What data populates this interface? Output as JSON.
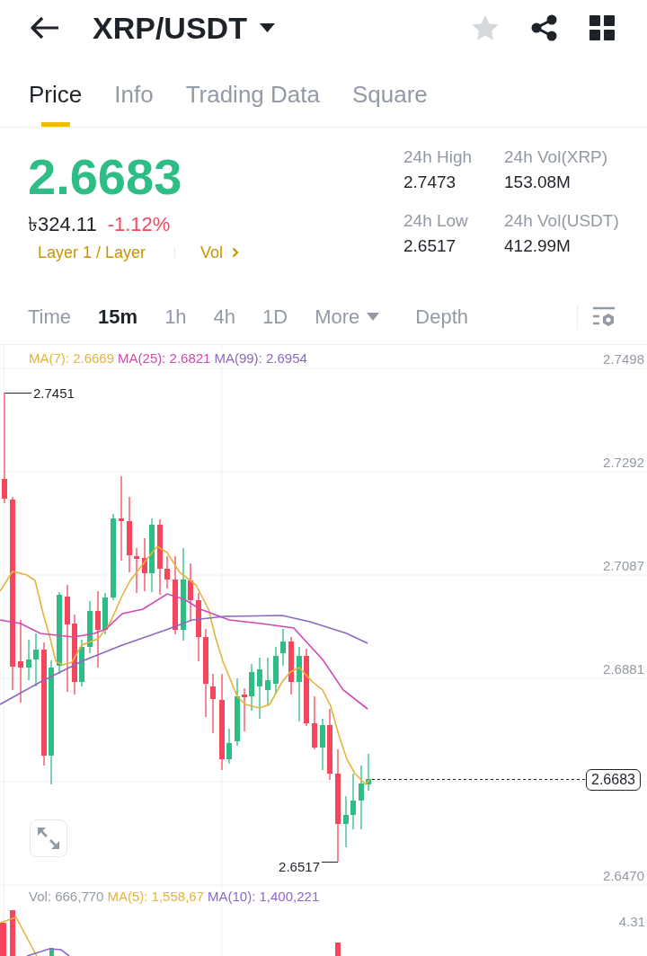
{
  "header": {
    "title": "XRP/USDT",
    "favorite": false
  },
  "tabs": [
    {
      "label": "Price",
      "selected": true
    },
    {
      "label": "Info",
      "selected": false
    },
    {
      "label": "Trading Data",
      "selected": false
    },
    {
      "label": "Square",
      "selected": false
    }
  ],
  "ticker": {
    "price": "2.6683",
    "price_rising": true,
    "local_price": "৳324.11",
    "change": "-1.12%",
    "change_rising": false
  },
  "tags": [
    {
      "label": "Layer 1 / Layer",
      "kind": "plain"
    },
    {
      "label": "Vol",
      "kind": "more"
    }
  ],
  "stats": [
    {
      "label": "24h High",
      "value": "2.7473"
    },
    {
      "label": "24h Vol(XRP)",
      "value": "153.08M"
    },
    {
      "label": "24h Low",
      "value": "2.6517"
    },
    {
      "label": "24h Vol(USDT)",
      "value": "412.99M"
    }
  ],
  "intervals": [
    {
      "label": "Time",
      "selected": false,
      "kind": "option"
    },
    {
      "label": "15m",
      "selected": true,
      "kind": "option"
    },
    {
      "label": "1h",
      "selected": false,
      "kind": "option"
    },
    {
      "label": "4h",
      "selected": false,
      "kind": "option"
    },
    {
      "label": "1D",
      "selected": false,
      "kind": "option"
    },
    {
      "label": "More",
      "selected": false,
      "kind": "dropdown"
    },
    {
      "label": "Depth",
      "selected": false,
      "kind": "option"
    }
  ],
  "chart": {
    "indicators": [
      {
        "text": "MA(7): 2.6669",
        "color": "#e4b43c"
      },
      {
        "text": "MA(25): 2.6821",
        "color": "#d448b0"
      },
      {
        "text": "MA(99): 2.6954",
        "color": "#8a68c4"
      }
    ],
    "price_axis": [
      "2.7498",
      "2.7292",
      "2.7087",
      "2.6881",
      "2.6470"
    ],
    "high_marker": "2.7451",
    "low_marker": "2.6517",
    "last_price": "2.6683"
  },
  "volume": {
    "indicators": [
      {
        "text": "Vol: 666,770",
        "color": "#929aa5"
      },
      {
        "text": "MA(5): 1,558,67",
        "color": "#e4b43c"
      },
      {
        "text": "MA(10): 1,400,221",
        "color": "#8a68c4"
      }
    ],
    "axis_label": "4.31"
  }
}
